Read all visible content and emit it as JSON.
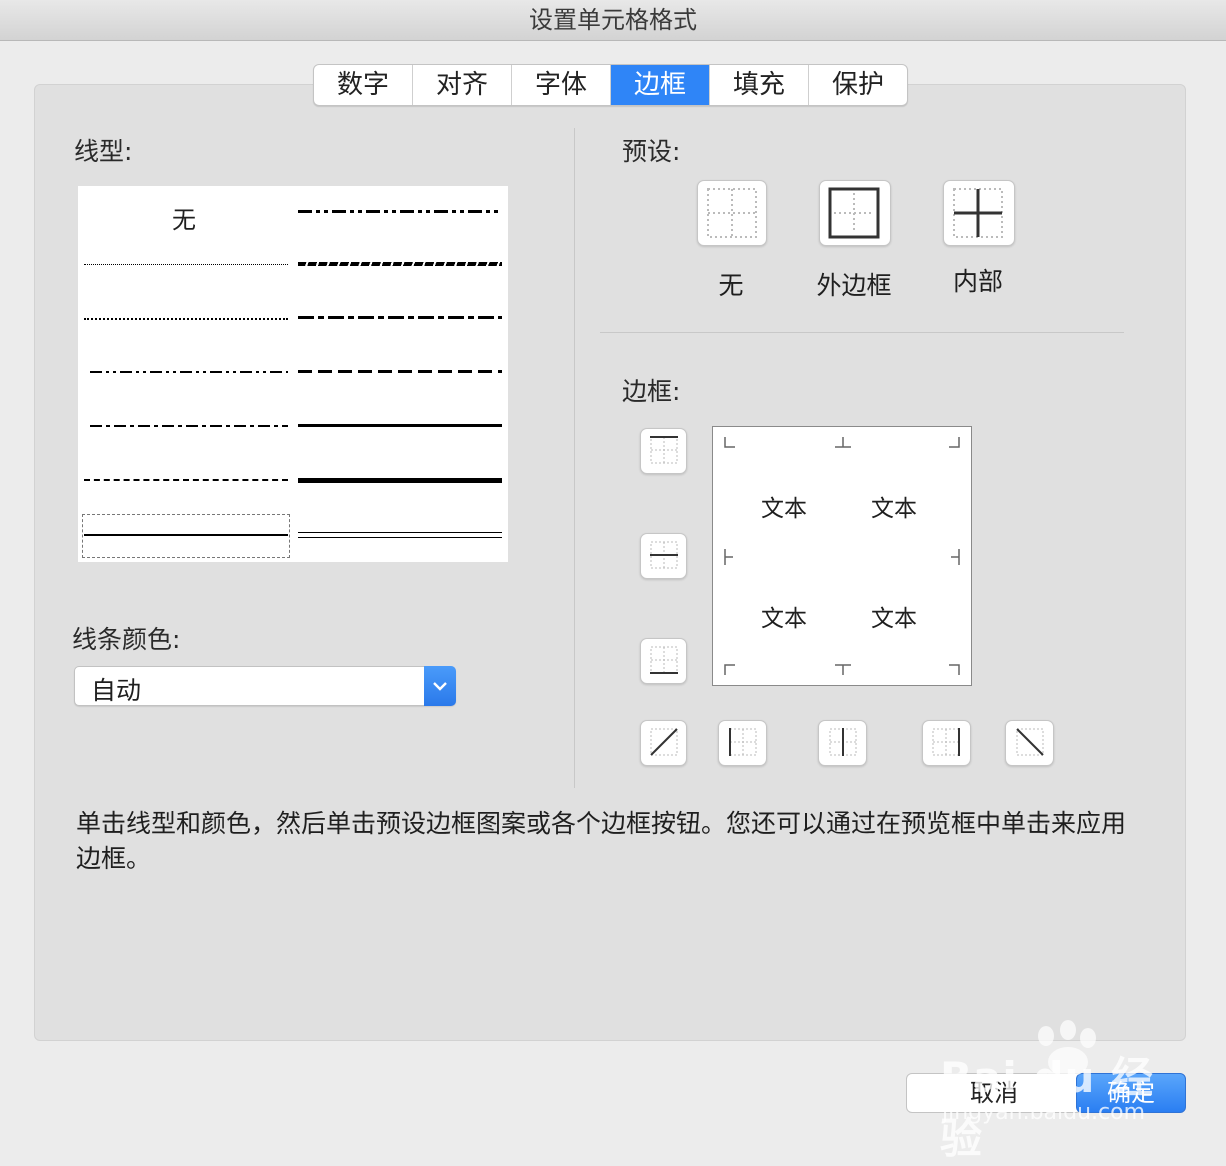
{
  "window": {
    "title": "设置单元格格式"
  },
  "tabs": [
    {
      "label": "数字"
    },
    {
      "label": "对齐"
    },
    {
      "label": "字体"
    },
    {
      "label": "边框"
    },
    {
      "label": "填充"
    },
    {
      "label": "保护"
    }
  ],
  "active_tab": "边框",
  "line_style": {
    "label": "线型:",
    "none_label": "无",
    "styles": [
      "none",
      "hair",
      "dotted",
      "dash-dot-dot",
      "dash-dot",
      "dashed",
      "thin",
      "medium-dash-dot-dot",
      "slanted-dash-dot",
      "medium-dash-dot",
      "medium-dashed",
      "medium",
      "thick",
      "double"
    ],
    "selected": "thin"
  },
  "line_color": {
    "label": "线条颜色:",
    "value": "自动"
  },
  "presets": {
    "label": "预设:",
    "items": [
      {
        "label": "无"
      },
      {
        "label": "外边框"
      },
      {
        "label": "内部"
      }
    ]
  },
  "border": {
    "label": "边框:",
    "preview_text": [
      "文本",
      "文本",
      "文本",
      "文本"
    ]
  },
  "help_text": "单击线型和颜色，然后单击预设边框图案或各个边框按钮。您还可以通过在预览框中单击来应用边框。",
  "footer": {
    "cancel_label": "取消",
    "ok_label": "确定"
  },
  "watermark": {
    "text": "Bai du 经验",
    "url": "jingyan.baidu.com"
  },
  "colors": {
    "accent": "#2f85f7",
    "panel": "#e0e0e0",
    "background": "#ececec"
  }
}
